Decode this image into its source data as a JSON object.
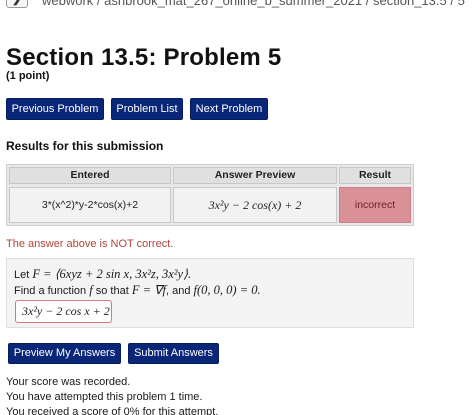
{
  "breadcrumb": {
    "toggle_glyph": "❯",
    "items": [
      "webwork",
      "ashbrook_mat_267_online_b_summer_2021",
      "section_13.5",
      "5"
    ],
    "separator": " / "
  },
  "problem_header": {
    "title": "Section 13.5: Problem 5",
    "points": "(1 point)"
  },
  "nav_buttons": {
    "previous": "Previous Problem",
    "list": "Problem List",
    "next": "Next Problem"
  },
  "results": {
    "heading": "Results for this submission",
    "columns": [
      "Entered",
      "Answer Preview",
      "Result"
    ],
    "row": {
      "entered": "3*(x^2)*y-2*cos(x)+2",
      "preview": "3x²y − 2 cos(x) + 2",
      "result": "incorrect"
    },
    "status_message": "The answer above is NOT correct."
  },
  "problem": {
    "line1_prefix": "Let ",
    "line1_math": "F = ⟨6xyz + 2 sin x, 3x²z, 3x²y⟩.",
    "line2_prefix": "Find a function ",
    "line2_f": "f",
    "line2_mid": " so that ",
    "line2_math1": "F = ∇f",
    "line2_and": ", and ",
    "line2_math2": "f(0, 0, 0) = 0.",
    "answer_value": "3x²y − 2 cos x + 2"
  },
  "actions": {
    "preview": "Preview My Answers",
    "submit": "Submit Answers"
  },
  "messages": [
    "Your score was recorded.",
    "You have attempted this problem 1 time.",
    "You received a score of 0% for this attempt."
  ],
  "colors": {
    "button_bg": "#0a2679",
    "incorrect_bg": "#d99096",
    "error_text": "#b0453a"
  }
}
